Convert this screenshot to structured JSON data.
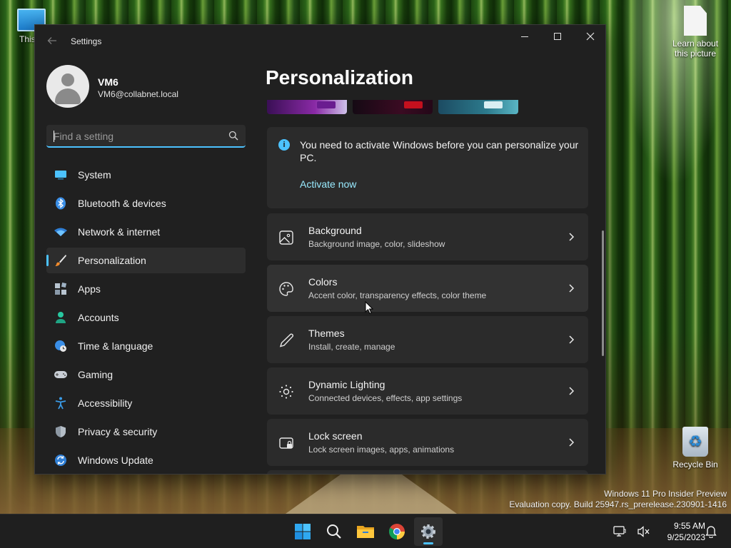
{
  "desktop": {
    "icons": {
      "this_pc": "This P",
      "learn": "Learn about this picture",
      "recycle_bin": "Recycle Bin"
    },
    "watermark": {
      "line1": "Windows 11 Pro Insider Preview",
      "line2": "Evaluation copy. Build 25947.rs_prerelease.230901-1416"
    }
  },
  "window": {
    "title": "Settings",
    "profile": {
      "name": "VM6",
      "email": "VM6@collabnet.local"
    },
    "search": {
      "placeholder": "Find a setting"
    },
    "nav": [
      {
        "label": "System",
        "icon": "system-icon",
        "active": false
      },
      {
        "label": "Bluetooth & devices",
        "icon": "bluetooth-icon",
        "active": false
      },
      {
        "label": "Network & internet",
        "icon": "wifi-icon",
        "active": false
      },
      {
        "label": "Personalization",
        "icon": "brush-icon",
        "active": true
      },
      {
        "label": "Apps",
        "icon": "apps-icon",
        "active": false
      },
      {
        "label": "Accounts",
        "icon": "accounts-icon",
        "active": false
      },
      {
        "label": "Time & language",
        "icon": "globe-clock-icon",
        "active": false
      },
      {
        "label": "Gaming",
        "icon": "gamepad-icon",
        "active": false
      },
      {
        "label": "Accessibility",
        "icon": "accessibility-icon",
        "active": false
      },
      {
        "label": "Privacy & security",
        "icon": "shield-icon",
        "active": false
      },
      {
        "label": "Windows Update",
        "icon": "update-icon",
        "active": false
      }
    ],
    "page_title": "Personalization",
    "notice": {
      "text": "You need to activate Windows before you can personalize your PC.",
      "link": "Activate now"
    },
    "cards": [
      {
        "title": "Background",
        "subtitle": "Background image, color, slideshow",
        "icon": "image-icon"
      },
      {
        "title": "Colors",
        "subtitle": "Accent color, transparency effects, color theme",
        "icon": "palette-icon"
      },
      {
        "title": "Themes",
        "subtitle": "Install, create, manage",
        "icon": "pen-icon"
      },
      {
        "title": "Dynamic Lighting",
        "subtitle": "Connected devices, effects, app settings",
        "icon": "lighting-icon"
      },
      {
        "title": "Lock screen",
        "subtitle": "Lock screen images, apps, animations",
        "icon": "lock-screen-icon"
      }
    ]
  },
  "taskbar": {
    "time": "9:55 AM",
    "date": "9/25/2023",
    "apps": [
      "start-icon",
      "search-icon",
      "file-explorer-icon",
      "chrome-icon",
      "settings-icon"
    ],
    "accent": "#4cc2ff"
  }
}
